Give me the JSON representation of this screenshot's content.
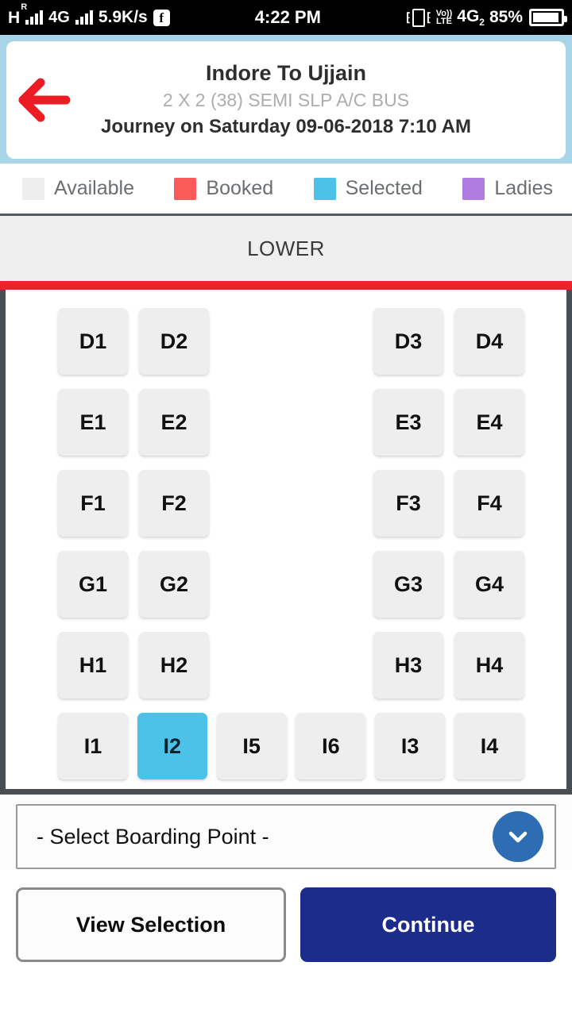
{
  "statusbar": {
    "network_type": "H",
    "roaming": "R",
    "network_2": "4G",
    "data_speed": "5.9K/s",
    "facebook_glyph": "f",
    "time": "4:22 PM",
    "volte_top": "Vo))",
    "volte_bottom": "LTE",
    "sim2": "4G",
    "sim2_index": "2",
    "battery_percent": "85%"
  },
  "header": {
    "back_icon": "arrow-left-icon",
    "title": "Indore To Ujjain",
    "bus_type": "2 X 2 (38) SEMI SLP A/C BUS",
    "journey_label": "Journey on",
    "journey_value": "Saturday 09-06-2018  7:10 AM"
  },
  "legend": {
    "items": [
      {
        "label": "Available",
        "color": "#eeeeee"
      },
      {
        "label": "Booked",
        "color": "#fa5a5a"
      },
      {
        "label": "Selected",
        "color": "#4cc2e8"
      },
      {
        "label": "Ladies",
        "color": "#b07be0"
      }
    ]
  },
  "deck": {
    "title": "LOWER",
    "rows": [
      {
        "type": "quad",
        "left": [
          "D1",
          "D2"
        ],
        "right": [
          "D3",
          "D4"
        ]
      },
      {
        "type": "quad",
        "left": [
          "E1",
          "E2"
        ],
        "right": [
          "E3",
          "E4"
        ]
      },
      {
        "type": "quad",
        "left": [
          "F1",
          "F2"
        ],
        "right": [
          "F3",
          "F4"
        ]
      },
      {
        "type": "quad",
        "left": [
          "G1",
          "G2"
        ],
        "right": [
          "G3",
          "G4"
        ]
      },
      {
        "type": "quad",
        "left": [
          "H1",
          "H2"
        ],
        "right": [
          "H3",
          "H4"
        ]
      },
      {
        "type": "back",
        "seats": [
          "I1",
          "I2",
          "I5",
          "I6",
          "I3",
          "I4"
        ]
      }
    ],
    "selected_seats": [
      "I2"
    ]
  },
  "boarding": {
    "placeholder": "- Select Boarding Point -",
    "dropdown_icon": "chevron-down-icon"
  },
  "footer": {
    "view_selection_label": "View Selection",
    "continue_label": "Continue"
  },
  "colors": {
    "page_bg": "#a8d4e8",
    "accent_red": "#e8252a",
    "primary_blue": "#1b2c8a",
    "dropdown_blue": "#2e6db4",
    "selected_seat": "#4cc2e8",
    "available_seat": "#eeeeee"
  }
}
